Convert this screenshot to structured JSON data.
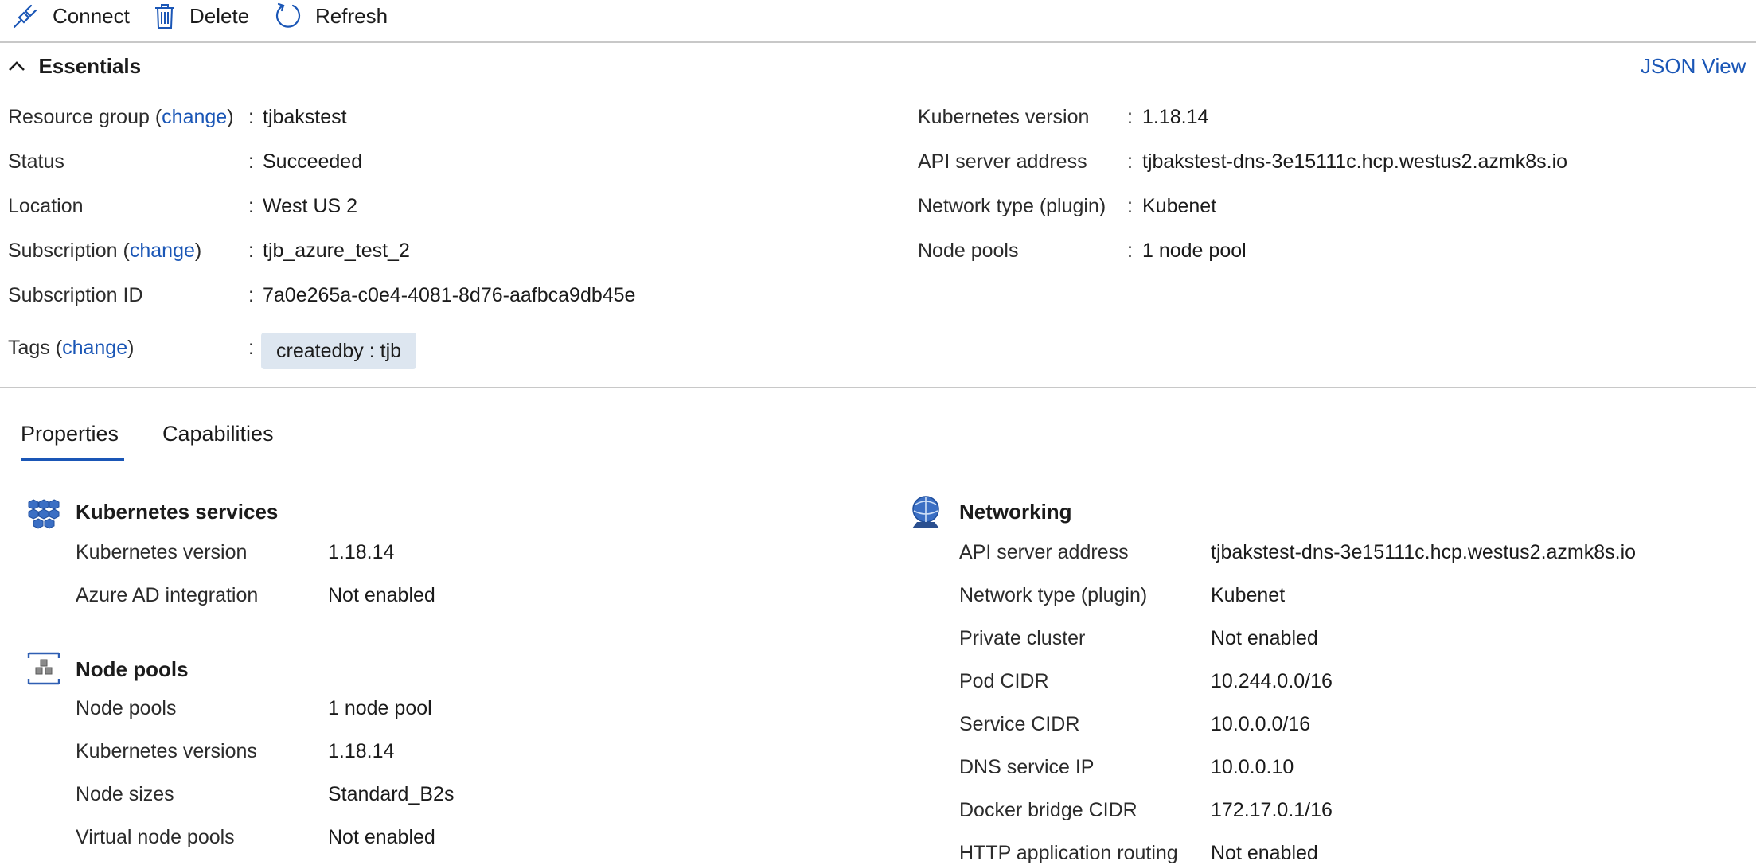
{
  "toolbar": {
    "connect": "Connect",
    "delete": "Delete",
    "refresh": "Refresh"
  },
  "essentials": {
    "title": "Essentials",
    "json_view": "JSON View",
    "change": "change",
    "left": [
      {
        "label": "Resource group",
        "value": "tjbakstest"
      },
      {
        "label": "Status",
        "value": "Succeeded"
      },
      {
        "label": "Location",
        "value": "West US 2"
      },
      {
        "label": "Subscription",
        "value": "tjb_azure_test_2"
      },
      {
        "label": "Subscription ID",
        "value": "7a0e265a-c0e4-4081-8d76-aafbca9db45e"
      },
      {
        "label": "Tags",
        "value": "createdby : tjb"
      }
    ],
    "right": [
      {
        "label": "Kubernetes version",
        "value": "1.18.14"
      },
      {
        "label": "API server address",
        "value": "tjbakstest-dns-3e15111c.hcp.westus2.azmk8s.io"
      },
      {
        "label": "Network type (plugin)",
        "value": "Kubenet"
      },
      {
        "label": "Node pools",
        "value": "1 node pool"
      }
    ]
  },
  "tabs": [
    "Properties",
    "Capabilities"
  ],
  "properties": {
    "kubernetes_services": {
      "title": "Kubernetes services",
      "icon": "kubernetes-services-icon",
      "rows": [
        {
          "label": "Kubernetes version",
          "value": "1.18.14"
        },
        {
          "label": "Azure AD integration",
          "value": "Not enabled"
        }
      ]
    },
    "node_pools": {
      "title": "Node pools",
      "icon": "node-pools-icon",
      "rows": [
        {
          "label": "Node pools",
          "value": "1 node pool"
        },
        {
          "label": "Kubernetes versions",
          "value": "1.18.14"
        },
        {
          "label": "Node sizes",
          "value": "Standard_B2s"
        },
        {
          "label": "Virtual node pools",
          "value": "Not enabled"
        }
      ]
    },
    "networking": {
      "title": "Networking",
      "icon": "networking-icon",
      "rows": [
        {
          "label": "API server address",
          "value": "tjbakstest-dns-3e15111c.hcp.westus2.azmk8s.io"
        },
        {
          "label": "Network type (plugin)",
          "value": "Kubenet"
        },
        {
          "label": "Private cluster",
          "value": "Not enabled"
        },
        {
          "label": "Pod CIDR",
          "value": "10.244.0.0/16"
        },
        {
          "label": "Service CIDR",
          "value": "10.0.0.0/16"
        },
        {
          "label": "DNS service IP",
          "value": "10.0.0.10"
        },
        {
          "label": "Docker bridge CIDR",
          "value": "172.17.0.1/16"
        },
        {
          "label": "HTTP application routing",
          "value": "Not enabled"
        }
      ]
    }
  },
  "colors": {
    "link": "#1a56b6",
    "tag_bg": "#dde6f0",
    "divider": "#c8c8c8"
  }
}
